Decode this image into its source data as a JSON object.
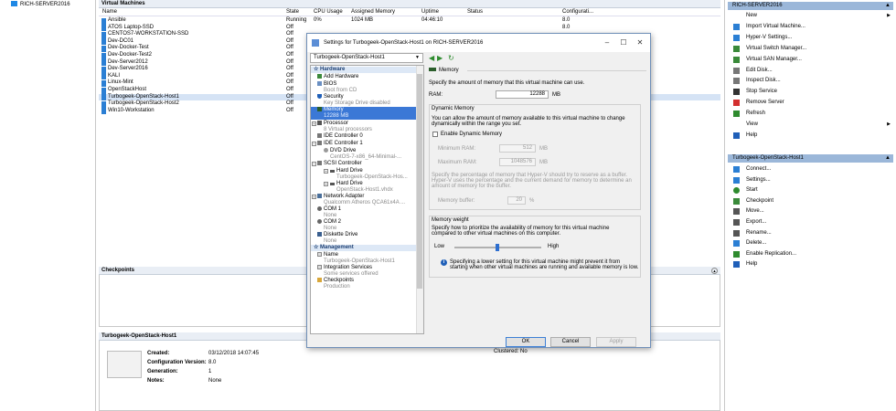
{
  "tree": {
    "server": "RICH-SERVER2016"
  },
  "vms": {
    "title": "Virtual Machines",
    "columns": [
      "Name",
      "State",
      "CPU Usage",
      "Assigned Memory",
      "Uptime",
      "Status",
      "Configurati..."
    ],
    "rows": [
      [
        "Ansible",
        "Running",
        "0%",
        "1024 MB",
        "04:46:10",
        "",
        "8.0"
      ],
      [
        "ATOS Laptop-SSD",
        "Off",
        "",
        "",
        "",
        "",
        "8.0"
      ],
      [
        "CENTOS7-WORKSTATION-SSD",
        "Off",
        "",
        "",
        "",
        "",
        ""
      ],
      [
        "Dev-DC01",
        "Off",
        "",
        "",
        "",
        "",
        ""
      ],
      [
        "Dev-Docker-Test",
        "Off",
        "",
        "",
        "",
        "",
        ""
      ],
      [
        "Dev-Docker-Test2",
        "Off",
        "",
        "",
        "",
        "",
        ""
      ],
      [
        "Dev-Server2012",
        "Off",
        "",
        "",
        "",
        "",
        ""
      ],
      [
        "Dev-Server2016",
        "Off",
        "",
        "",
        "",
        "",
        ""
      ],
      [
        "KALI",
        "Off",
        "",
        "",
        "",
        "",
        ""
      ],
      [
        "Linux-Mint",
        "Off",
        "",
        "",
        "",
        "",
        ""
      ],
      [
        "OpenStackHost",
        "Off",
        "",
        "",
        "",
        "",
        ""
      ],
      [
        "Turbogeek-OpenStack-Host1",
        "Off",
        "",
        "",
        "",
        "",
        ""
      ],
      [
        "Turbogeek-OpenStack-Host2",
        "Off",
        "",
        "",
        "",
        "",
        ""
      ],
      [
        "Win10-Workstation",
        "Off",
        "",
        "",
        "",
        "",
        ""
      ]
    ]
  },
  "checkpoints": {
    "title": "Checkpoints"
  },
  "details": {
    "title": "Turbogeek-OpenStack-Host1",
    "created_label": "Created:",
    "created": "03/12/2018 14:07:45",
    "config_label": "Configuration Version:",
    "config": "8.0",
    "gen_label": "Generation:",
    "gen": "1",
    "notes_label": "Notes:",
    "notes": "None",
    "clustered": "Clustered: No"
  },
  "actions": {
    "server_title": "RICH-SERVER2016",
    "server_items": [
      "New",
      "Import Virtual Machine...",
      "Hyper-V Settings...",
      "Virtual Switch Manager...",
      "Virtual SAN Manager...",
      "Edit Disk...",
      "Inspect Disk...",
      "Stop Service",
      "Remove Server",
      "Refresh",
      "View",
      "Help"
    ],
    "vm_title": "Turbogeek-OpenStack-Host1",
    "vm_items": [
      "Connect...",
      "Settings...",
      "Start",
      "Checkpoint",
      "Move...",
      "Export...",
      "Rename...",
      "Delete...",
      "Enable Replication...",
      "Help"
    ]
  },
  "dialog": {
    "title": "Settings for Turbogeek-OpenStack-Host1 on RICH-SERVER2016",
    "vm_selector": "Turbogeek-OpenStack-Host1",
    "hw_section": "Hardware",
    "mgmt_section": "Management",
    "items": {
      "add_hw": "Add Hardware",
      "bios": "BIOS",
      "bios_sub": "Boot from CD",
      "security": "Security",
      "security_sub": "Key Storage Drive disabled",
      "memory": "Memory",
      "memory_sub": "12288 MB",
      "processor": "Processor",
      "processor_sub": "8 Virtual processors",
      "ide0": "IDE Controller 0",
      "ide1": "IDE Controller 1",
      "dvd": "DVD Drive",
      "dvd_sub": "CentOS-7-x86_64-Minimal-...",
      "scsi": "SCSI Controller",
      "hd1": "Hard Drive",
      "hd1_sub": "Turbogeek-OpenStack-Hos...",
      "hd2": "Hard Drive",
      "hd2_sub": "OpenStack-Host1.vhdx",
      "net": "Network Adapter",
      "net_sub": "Qualcomm Atheros QCA61x4A ...",
      "com1": "COM 1",
      "com1_sub": "None",
      "com2": "COM 2",
      "com2_sub": "None",
      "floppy": "Diskette Drive",
      "floppy_sub": "None",
      "name": "Name",
      "name_sub": "Turbogeek-OpenStack-Host1",
      "integ": "Integration Services",
      "integ_sub": "Some services offered",
      "chk": "Checkpoints",
      "chk_sub": "Production"
    },
    "memory": {
      "group": "Memory",
      "intro": "Specify the amount of memory that this virtual machine can use.",
      "ram_label": "RAM:",
      "ram": "12288",
      "unit": "MB",
      "dyn_title": "Dynamic Memory",
      "dyn_text1": "You can allow the amount of memory available to this virtual machine to change",
      "dyn_text2": "dynamically within the range you set.",
      "dyn_enable": "Enable Dynamic Memory",
      "min_label": "Minimum RAM:",
      "min": "512",
      "max_label": "Maximum RAM:",
      "max": "1048576",
      "buf_text1": "Specify the percentage of memory that Hyper-V should try to reserve as a buffer.",
      "buf_text2": "Hyper-V uses the percentage and the current demand for memory to determine an",
      "buf_text3": "amount of memory for the buffer.",
      "buf_label": "Memory buffer:",
      "buf": "20",
      "pct": "%",
      "weight_title": "Memory weight",
      "weight_text1": "Specify how to prioritize the availability of memory for this virtual machine",
      "weight_text2": "compared to other virtual machines on this computer.",
      "low": "Low",
      "high": "High",
      "info1": "Specifying a lower setting for this virtual machine might prevent it from",
      "info2": "starting when other virtual machines are running and available memory is low."
    },
    "buttons": {
      "ok": "OK",
      "cancel": "Cancel",
      "apply": "Apply"
    }
  }
}
